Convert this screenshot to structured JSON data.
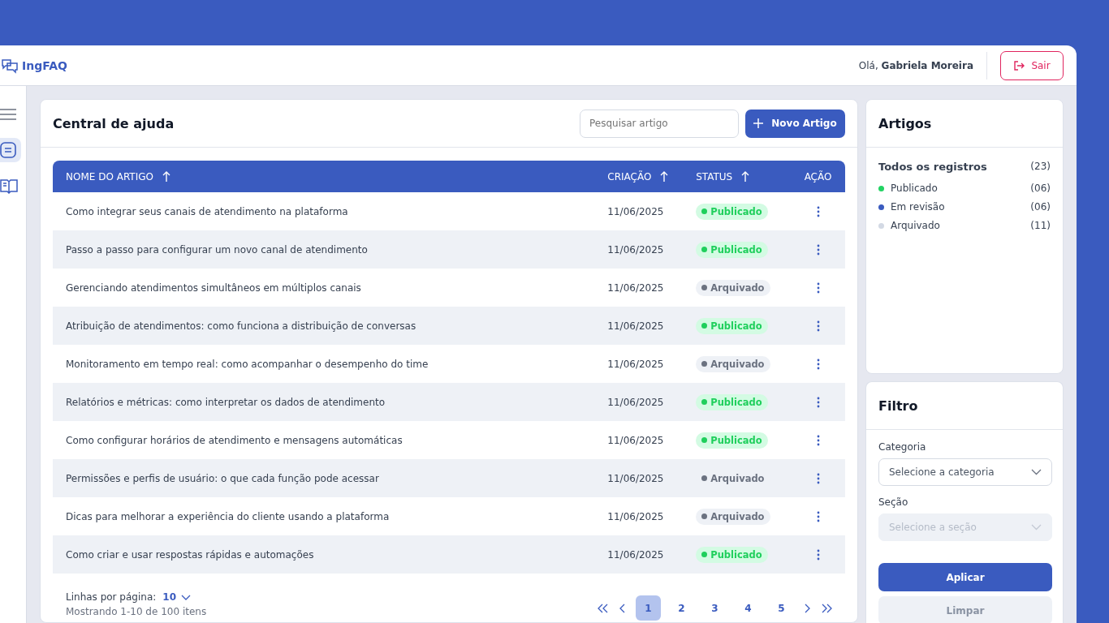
{
  "header": {
    "brand": "IngFAQ",
    "greeting": "Olá,",
    "user": "Gabriela Moreira",
    "logout": "Sair"
  },
  "sidebar": {
    "items": [
      {
        "kind": "menu",
        "selected": false
      },
      {
        "kind": "list",
        "selected": true
      },
      {
        "kind": "book",
        "selected": false
      }
    ]
  },
  "main": {
    "title": "Central de ajuda",
    "search": {
      "placeholder": "Pesquisar artigo"
    },
    "new_button": "Novo Artigo",
    "table": {
      "columns": [
        {
          "label": "NOME DO ARTIGO",
          "sortable": true
        },
        {
          "label": "CRIAÇÃO",
          "sortable": true
        },
        {
          "label": "STATUS",
          "sortable": true
        },
        {
          "label": "AÇÃO",
          "sortable": false
        }
      ],
      "rows": [
        {
          "name": "Como integrar seus canais de atendimento na plataforma",
          "date": "11/06/2025",
          "status": "Publicado",
          "kind": "published"
        },
        {
          "name": "Passo a passo para configurar um novo canal de atendimento",
          "date": "11/06/2025",
          "status": "Publicado",
          "kind": "published"
        },
        {
          "name": "Gerenciando atendimentos simultâneos em múltiplos canais",
          "date": "11/06/2025",
          "status": "Arquivado",
          "kind": "archived"
        },
        {
          "name": "Atribuição de atendimentos: como funciona a distribuição de conversas",
          "date": "11/06/2025",
          "status": "Publicado",
          "kind": "published"
        },
        {
          "name": "Monitoramento em tempo real: como acompanhar o desempenho do time",
          "date": "11/06/2025",
          "status": "Arquivado",
          "kind": "archived"
        },
        {
          "name": "Relatórios e métricas: como interpretar os dados de atendimento",
          "date": "11/06/2025",
          "status": "Publicado",
          "kind": "published"
        },
        {
          "name": "Como configurar horários de atendimento e mensagens automáticas",
          "date": "11/06/2025",
          "status": "Publicado",
          "kind": "published"
        },
        {
          "name": "Permissões e perfis de usuário: o que cada função pode acessar",
          "date": "11/06/2025",
          "status": "Arquivado",
          "kind": "archived"
        },
        {
          "name": "Dicas para melhorar a experiência do cliente usando a plataforma",
          "date": "11/06/2025",
          "status": "Arquivado",
          "kind": "archived"
        },
        {
          "name": "Como criar e usar respostas rápidas e automações",
          "date": "11/06/2025",
          "status": "Publicado",
          "kind": "published"
        }
      ]
    },
    "footer": {
      "rows_label": "Linhas por página:",
      "rows_value": "10",
      "showing": "Mostrando 1-10 de 100 itens",
      "pages": [
        {
          "label": "1",
          "selected": true
        },
        {
          "label": "2",
          "selected": false
        },
        {
          "label": "3",
          "selected": false
        },
        {
          "label": "4",
          "selected": false
        },
        {
          "label": "5",
          "selected": false
        }
      ]
    }
  },
  "articles": {
    "title": "Artigos",
    "total_label": "Todos os registros",
    "total_count": "(23)",
    "items": [
      {
        "label": "Publicado",
        "count": "(06)",
        "color": "#22d363"
      },
      {
        "label": "Em revisão",
        "count": "(06)",
        "color": "#3a5bbf"
      },
      {
        "label": "Arquivado",
        "count": "(11)",
        "color": "#d3d9e4"
      }
    ]
  },
  "filter": {
    "title": "Filtro",
    "fields": [
      {
        "label": "Categoria",
        "placeholder": "Selecione a categoria",
        "disabled": false
      },
      {
        "label": "Seção",
        "placeholder": "Selecione a seção",
        "disabled": true
      }
    ],
    "apply": "Aplicar",
    "clear": "Limpar"
  }
}
